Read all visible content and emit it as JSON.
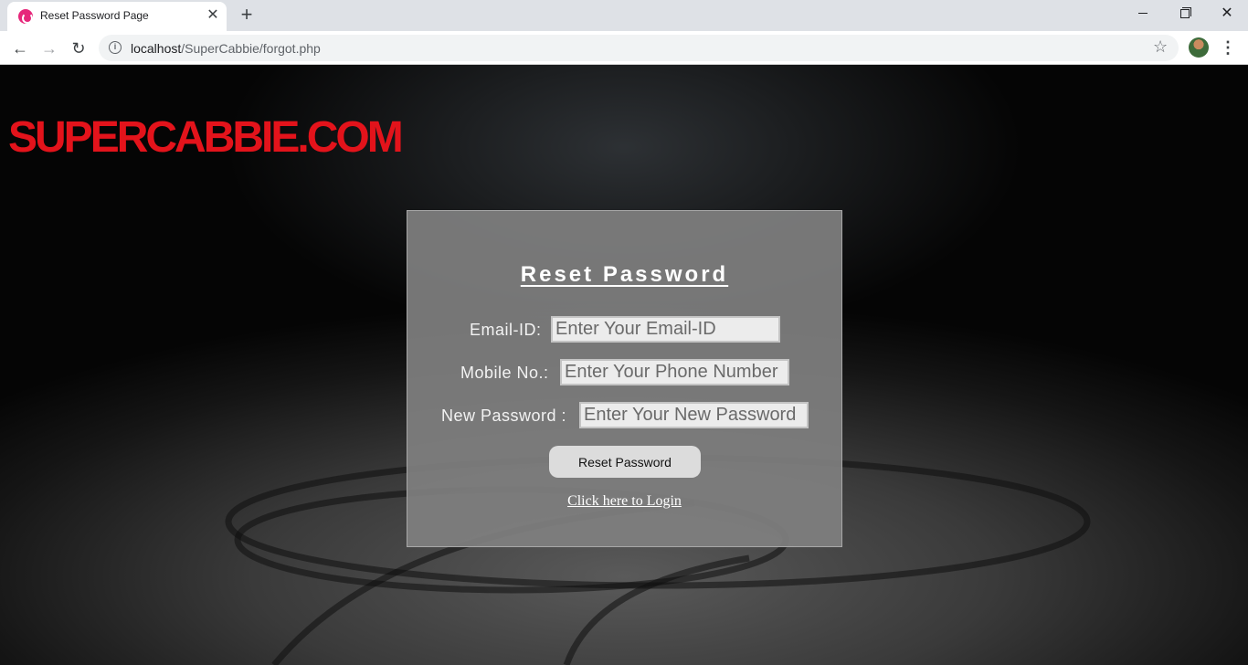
{
  "browser": {
    "tab_title": "Reset Password Page",
    "url_host": "localhost",
    "url_path": "/SuperCabbie/forgot.php"
  },
  "page": {
    "logo": "SUPERCABBIE.COM",
    "form": {
      "title": "Reset Password",
      "email_label": "Email-ID:",
      "email_placeholder": "Enter Your Email-ID",
      "mobile_label": "Mobile No.:",
      "mobile_placeholder": "Enter Your Phone Number",
      "password_label": "New Password :",
      "password_placeholder": "Enter Your New Password",
      "submit_label": "Reset Password",
      "login_link": "Click here to Login"
    }
  },
  "colors": {
    "logo_red": "#e3131b",
    "panel_grey": "#808080",
    "button_bg": "#dcdcdc"
  }
}
